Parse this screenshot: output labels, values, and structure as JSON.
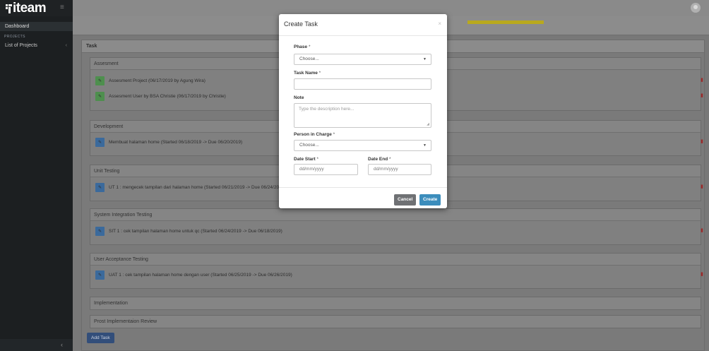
{
  "app": {
    "logo_text": "iteam",
    "hamburger_icon": "menu-icon",
    "avatar_icon": "user-avatar"
  },
  "sidebar": {
    "dashboard": "Dashboard",
    "projects_heading": "PROJECTS",
    "list_of_projects": "List of Projects",
    "list_chevron": "‹",
    "collapse_icon": "‹"
  },
  "colors": {
    "progress_bar": "#b9a91e",
    "primary_button": "#3c8dbc",
    "cancel_button": "#6f7174",
    "add_task_button": "#324e7a",
    "delete_icon": "#9b2c2c"
  },
  "main": {
    "progress_fraction": 0.12,
    "task_panel_title": "Task",
    "phases": [
      {
        "title": "Assesment",
        "tasks": [
          {
            "icon": "green",
            "text": "Assesment Project  (06/17/2019 by Agung Wira)"
          },
          {
            "icon": "green",
            "text": "Assesment User by BSA Christie  (06/17/2019 by Christie)"
          }
        ]
      },
      {
        "title": "Development",
        "tasks": [
          {
            "icon": "blue",
            "text": "Membuat halaman home  (Started 06/18/2019 -> Due 06/20/2019)"
          }
        ]
      },
      {
        "title": "Unit Testing",
        "tasks": [
          {
            "icon": "blue",
            "text": "UT 1 : mengecek tampilan dari halaman home  (Started 06/21/2019 -> Due 06/24/2019)"
          }
        ]
      },
      {
        "title": "System Integration Testing",
        "tasks": [
          {
            "icon": "blue",
            "text": "SIT 1 : cek tampilan halaman home untuk qc  (Started 06/24/2019 -> Due 06/18/2019)"
          }
        ]
      },
      {
        "title": "User Acceptance Testing",
        "tasks": [
          {
            "icon": "blue",
            "text": "UAT 1 : cek tampilan halaman home dengan user  (Started 06/25/2019 -> Due 06/26/2019)"
          }
        ]
      },
      {
        "title": "Implementation",
        "tasks": []
      },
      {
        "title": "Prost Implementaion Review",
        "tasks": []
      }
    ],
    "add_task_label": "Add Task"
  },
  "modal": {
    "title": "Create Task",
    "close_icon": "×",
    "phase_label": "Phase",
    "phase_selected": "Choose...",
    "task_name_label": "Task Name",
    "task_name_value": "",
    "note_label": "Note",
    "note_placeholder": "Type the description here...",
    "pic_label": "Person in Charge",
    "pic_selected": "Choose...",
    "date_start_label": "Date Start",
    "date_start_placeholder": "dd/mm/yyyy",
    "date_end_label": "Date End",
    "date_end_placeholder": "dd/mm/yyyy",
    "required_mark": "*",
    "cancel_label": "Cancel",
    "create_label": "Create"
  }
}
